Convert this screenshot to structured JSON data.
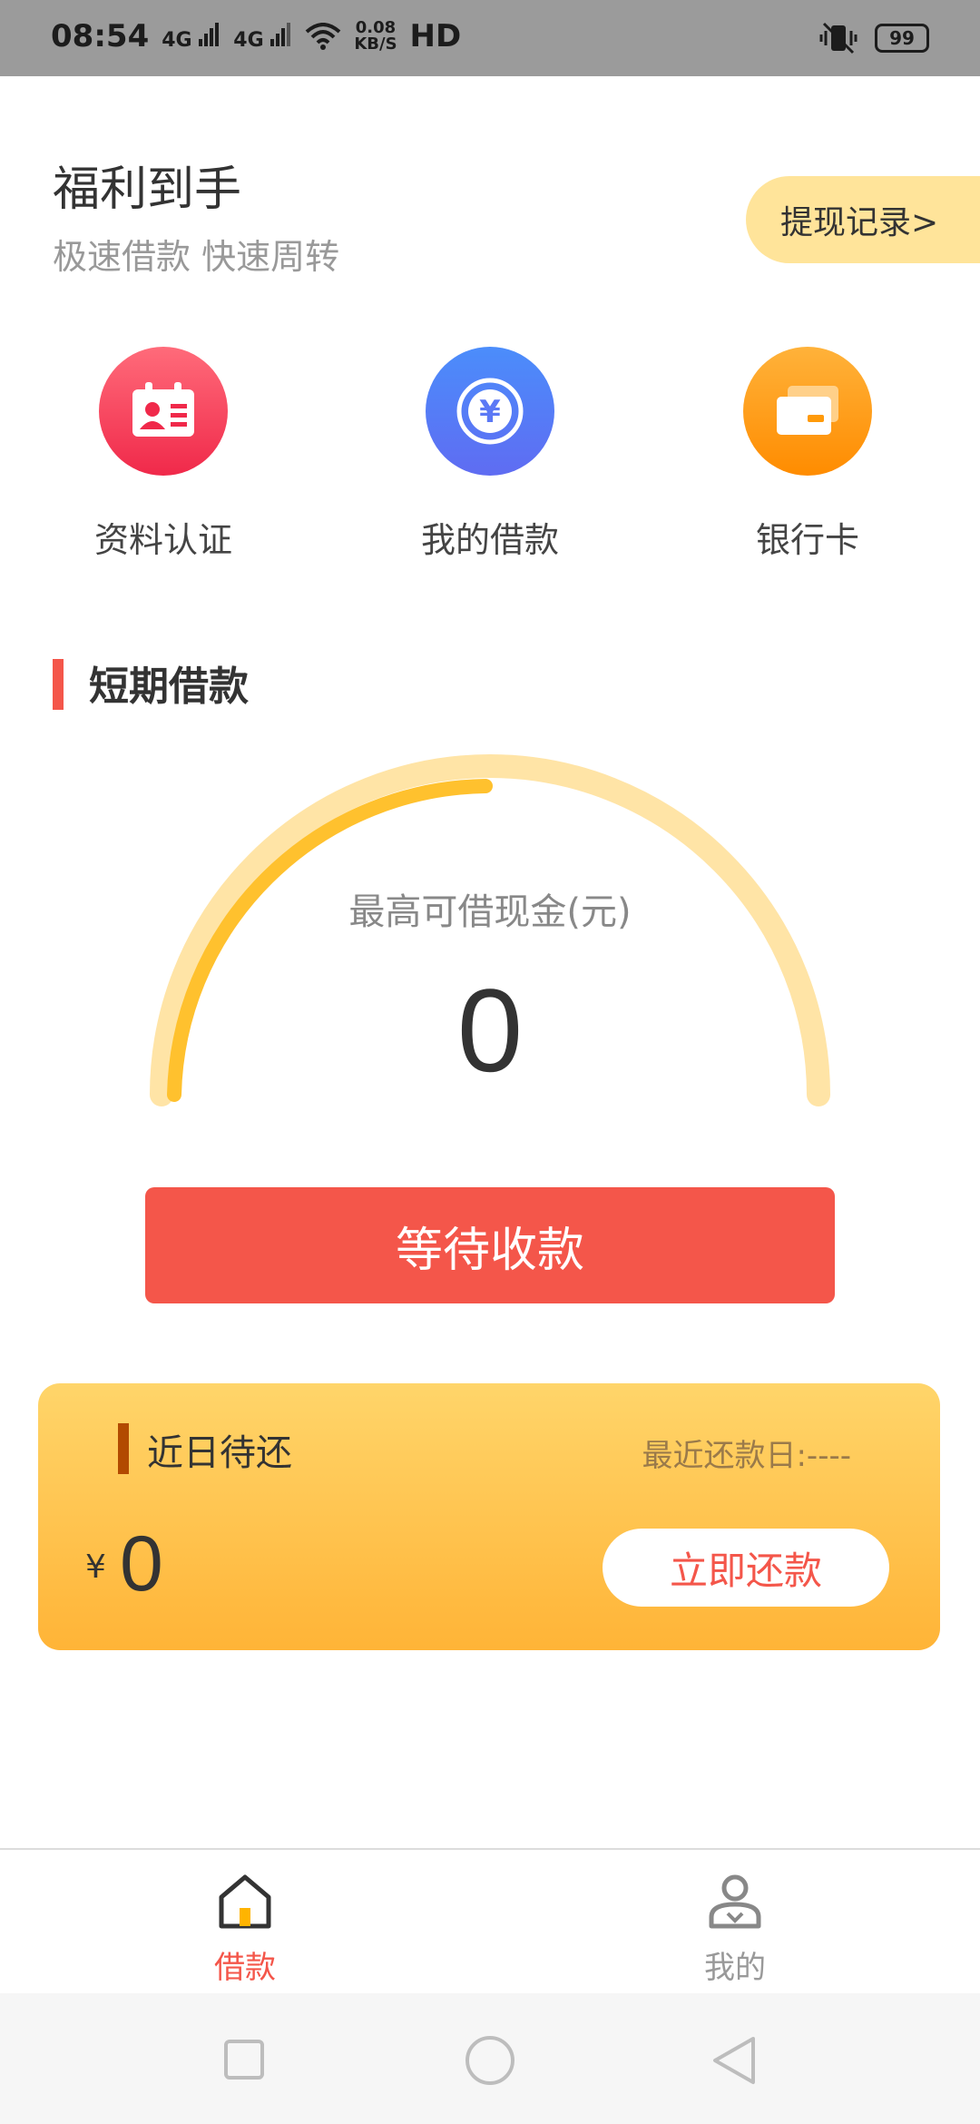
{
  "status_bar": {
    "time": "08:54",
    "network_1": "4G",
    "network_2": "4G",
    "speed_value": "0.08",
    "speed_unit": "KB/S",
    "hd_label": "HD",
    "battery": "99"
  },
  "header": {
    "title": "福利到手",
    "subtitle": "极速借款 快速周转",
    "withdraw_record": "提现记录>"
  },
  "quick_actions": [
    {
      "label": "资料认证",
      "icon": "id-card-icon",
      "color": "#f0294a"
    },
    {
      "label": "我的借款",
      "icon": "yuan-coin-icon",
      "color": "#4b8dfb"
    },
    {
      "label": "银行卡",
      "icon": "bank-card-icon",
      "color": "#ff8c00"
    }
  ],
  "section": {
    "title": "短期借款"
  },
  "gauge": {
    "caption": "最高可借现金(元)",
    "value": "0",
    "track_color": "#ffe4a6",
    "progress_color": "#ffc12e"
  },
  "main_button": {
    "label": "等待收款",
    "color": "#f4564a"
  },
  "repay_card": {
    "title": "近日待还",
    "date_label": "最近还款日:----",
    "currency": "¥",
    "amount": "0",
    "button_label": "立即还款"
  },
  "tabbar": {
    "items": [
      {
        "label": "借款",
        "icon": "home-icon",
        "active": true
      },
      {
        "label": "我的",
        "icon": "user-icon",
        "active": false
      }
    ]
  },
  "system_nav": {
    "icons": [
      "square-icon",
      "circle-icon",
      "back-triangle-icon"
    ]
  }
}
